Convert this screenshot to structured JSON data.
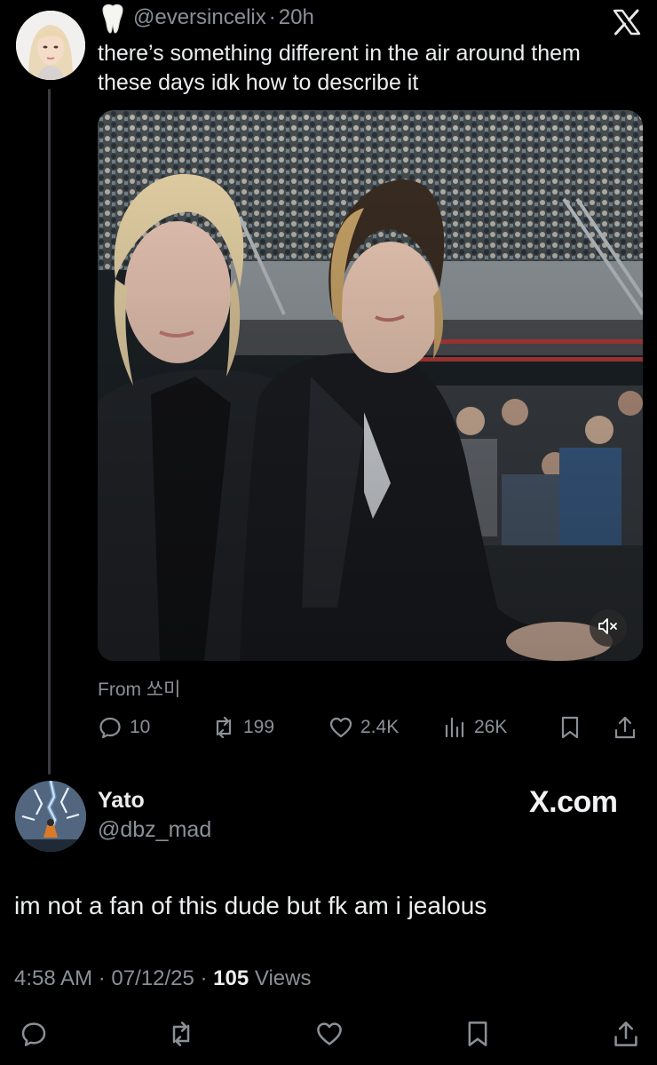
{
  "colors": {
    "background": "#000000",
    "text_primary": "#e7e9ea",
    "text_secondary": "#8b9096",
    "thread_line": "#3a3d41"
  },
  "quoted_tweet": {
    "emoji": "tooth-emoji",
    "handle": "@eversincelix",
    "separator": "·",
    "time": "20h",
    "brand_icon": "x-logo-icon",
    "text": "there’s something different in the air around them these days idk how to describe it",
    "media": {
      "type": "video",
      "mute_icon": "speaker-muted-icon"
    },
    "from_label": "From 쏘미",
    "actions": {
      "replies": "10",
      "reposts": "199",
      "likes": "2.4K",
      "views": "26K"
    }
  },
  "reply": {
    "display_name": "Yato",
    "handle": "@dbz_mad",
    "watermark": "X.com",
    "text": "im not a fan of this dude but fk am i jealous",
    "time": "4:58 AM",
    "separator": "·",
    "date": "07/12/25",
    "separator2": "·",
    "views_count": "105",
    "views_label": "Views"
  }
}
